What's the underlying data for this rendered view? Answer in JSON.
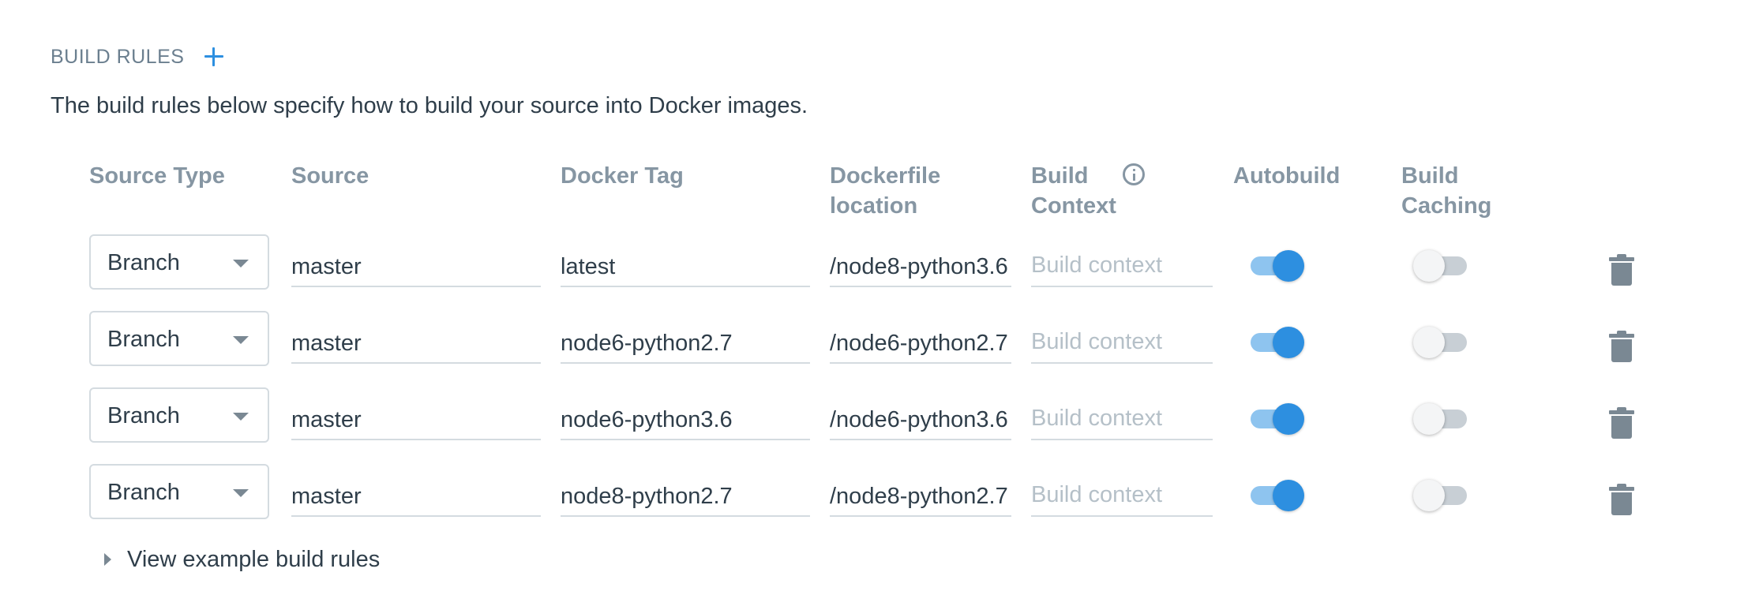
{
  "section": {
    "title": "BUILD RULES",
    "description": "The build rules below specify how to build your source into Docker images."
  },
  "columns": {
    "source_type": "Source Type",
    "source": "Source",
    "docker_tag": "Docker Tag",
    "dockerfile_line1": "Dockerfile",
    "dockerfile_line2": "location",
    "context_line1": "Build",
    "context_line2": "Context",
    "autobuild": "Autobuild",
    "caching_line1": "Build",
    "caching_line2": "Caching"
  },
  "rules": [
    {
      "source_type": "Branch",
      "source": "master",
      "docker_tag": "latest",
      "dockerfile": "/node8-python3.6",
      "build_context_placeholder": "Build context",
      "autobuild": true,
      "build_caching": false
    },
    {
      "source_type": "Branch",
      "source": "master",
      "docker_tag": "node6-python2.7",
      "dockerfile": "/node6-python2.7",
      "build_context_placeholder": "Build context",
      "autobuild": true,
      "build_caching": false
    },
    {
      "source_type": "Branch",
      "source": "master",
      "docker_tag": "node6-python3.6",
      "dockerfile": "/node6-python3.6",
      "build_context_placeholder": "Build context",
      "autobuild": true,
      "build_caching": false
    },
    {
      "source_type": "Branch",
      "source": "master",
      "docker_tag": "node8-python2.7",
      "dockerfile": "/node8-python2.7",
      "build_context_placeholder": "Build context",
      "autobuild": true,
      "build_caching": false
    }
  ],
  "example_link": "View example build rules",
  "colors": {
    "accent": "#2d8fe0",
    "header_text": "#8696a3",
    "body_text": "#2f3e4a"
  },
  "icons": {
    "add": "plus-icon",
    "info": "info-icon",
    "caret": "chevron-down-icon",
    "delete": "trash-icon",
    "expand": "caret-right-icon"
  }
}
